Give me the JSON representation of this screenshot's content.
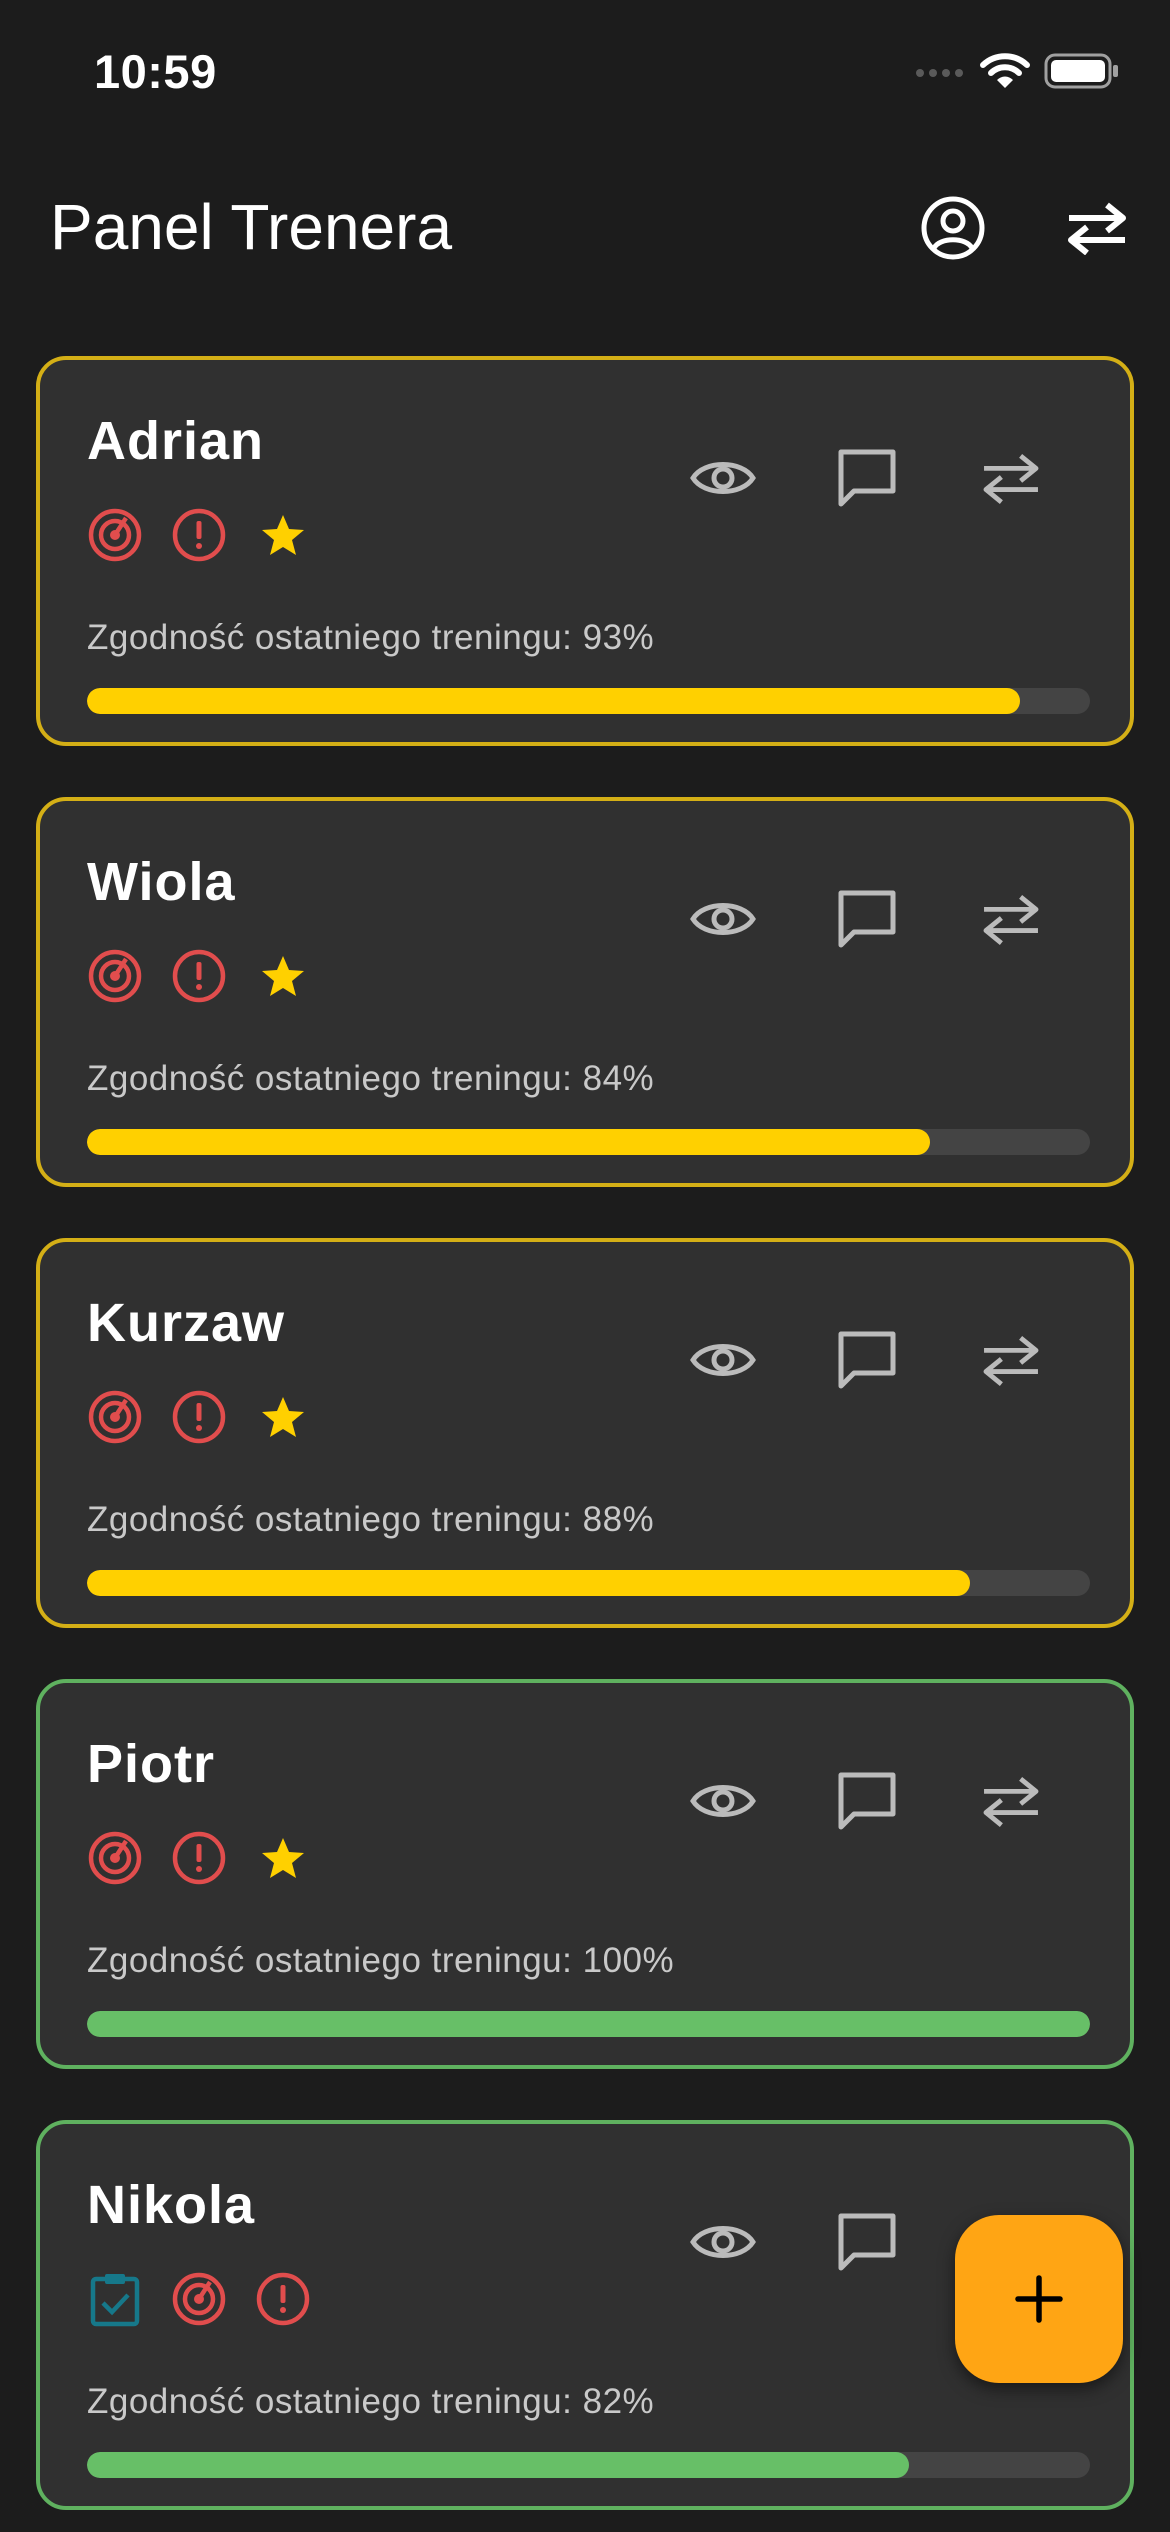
{
  "status_bar": {
    "time": "10:59"
  },
  "header": {
    "title": "Panel Trenera",
    "profile_icon": "account-circle-icon",
    "switch_icon": "swap-horizontal-icon"
  },
  "colors": {
    "background": "#1c1c1c",
    "card": "#303030",
    "yellow_border": "#d4af16",
    "green_border": "#5fb15f",
    "progress_yellow": "#ffd000",
    "progress_green": "#67bf67",
    "alert_red": "#e14d4d",
    "star_yellow": "#ffd000",
    "checklist_teal": "#16788a",
    "fab_orange": "#ffa514"
  },
  "cards": [
    {
      "name": "Adrian",
      "compliance_label": "Zgodność ostatniego treningu: 93%",
      "progress": 0.93,
      "status": "yellow",
      "badges": [
        "target-icon",
        "alert-circle-icon",
        "star-icon"
      ]
    },
    {
      "name": "Wiola",
      "compliance_label": "Zgodność ostatniego treningu: 84%",
      "progress": 0.84,
      "status": "yellow",
      "badges": [
        "target-icon",
        "alert-circle-icon",
        "star-icon"
      ]
    },
    {
      "name": "Kurzaw",
      "compliance_label": "Zgodność ostatniego treningu: 88%",
      "progress": 0.88,
      "status": "yellow",
      "badges": [
        "target-icon",
        "alert-circle-icon",
        "star-icon"
      ]
    },
    {
      "name": "Piotr",
      "compliance_label": "Zgodność ostatniego treningu: 100%",
      "progress": 1.0,
      "status": "green",
      "badges": [
        "target-icon",
        "alert-circle-icon",
        "star-icon"
      ]
    },
    {
      "name": "Nikola",
      "compliance_label": "Zgodność ostatniego treningu: 82%",
      "progress": 0.82,
      "status": "green",
      "badges": [
        "clipboard-check-icon",
        "target-icon",
        "alert-circle-icon"
      ]
    }
  ],
  "card_actions": [
    "eye-icon",
    "message-icon",
    "swap-horizontal-icon"
  ],
  "fab": {
    "label": "+",
    "icon": "plus-icon"
  }
}
